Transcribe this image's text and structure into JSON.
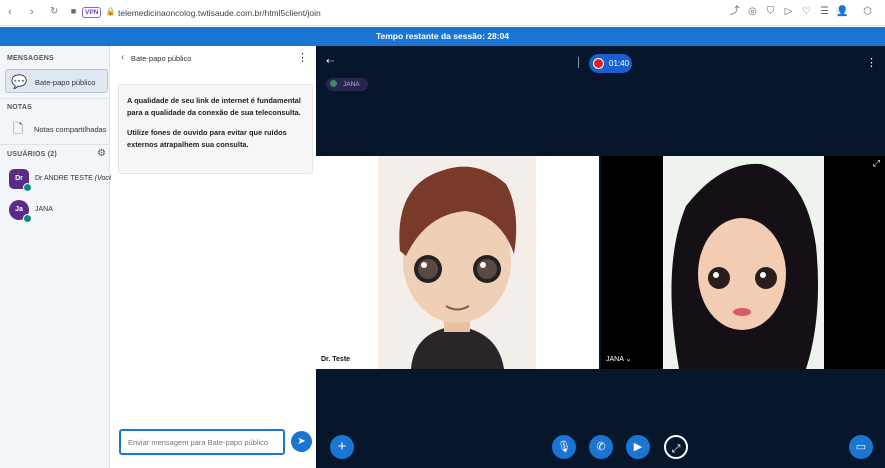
{
  "browser": {
    "url": "telemedicinaoncolog.twtisaude.com.br/html5client/join",
    "vpn_badge": "VPN"
  },
  "session_banner": "Tempo restante da sessão: 28:04",
  "sidebar": {
    "messages_header": "MENSAGENS",
    "public_chat_label": "Bate-papo público",
    "notes_header": "NOTAS",
    "shared_notes_label": "Notas compartilhadas",
    "users_header": "USUÁRIOS (2)",
    "users": [
      {
        "initials": "Dr",
        "name": "Dr ANDRE TESTE",
        "suffix": "(Você)"
      },
      {
        "initials": "Ja",
        "name": "JANA",
        "suffix": ""
      }
    ]
  },
  "chat": {
    "title": "Bate-papo público",
    "welcome_1": "A qualidade de seu link de internet é fundamental para a qualidade da conexão de sua teleconsulta.",
    "welcome_2": "Utilize fones de ouvido para evitar que ruídos externos atrapalhem sua consulta.",
    "input_placeholder": "Enviar mensagem para Bate-papo público"
  },
  "stage": {
    "presenter_chip": "JANA",
    "recording_time": "01:40",
    "videos": [
      {
        "label": "Dr. Teste"
      },
      {
        "label": "JANA"
      }
    ]
  },
  "colors": {
    "accent": "#1b76d3",
    "stage_bg": "#06172c",
    "avatar": "#5b2b88"
  }
}
